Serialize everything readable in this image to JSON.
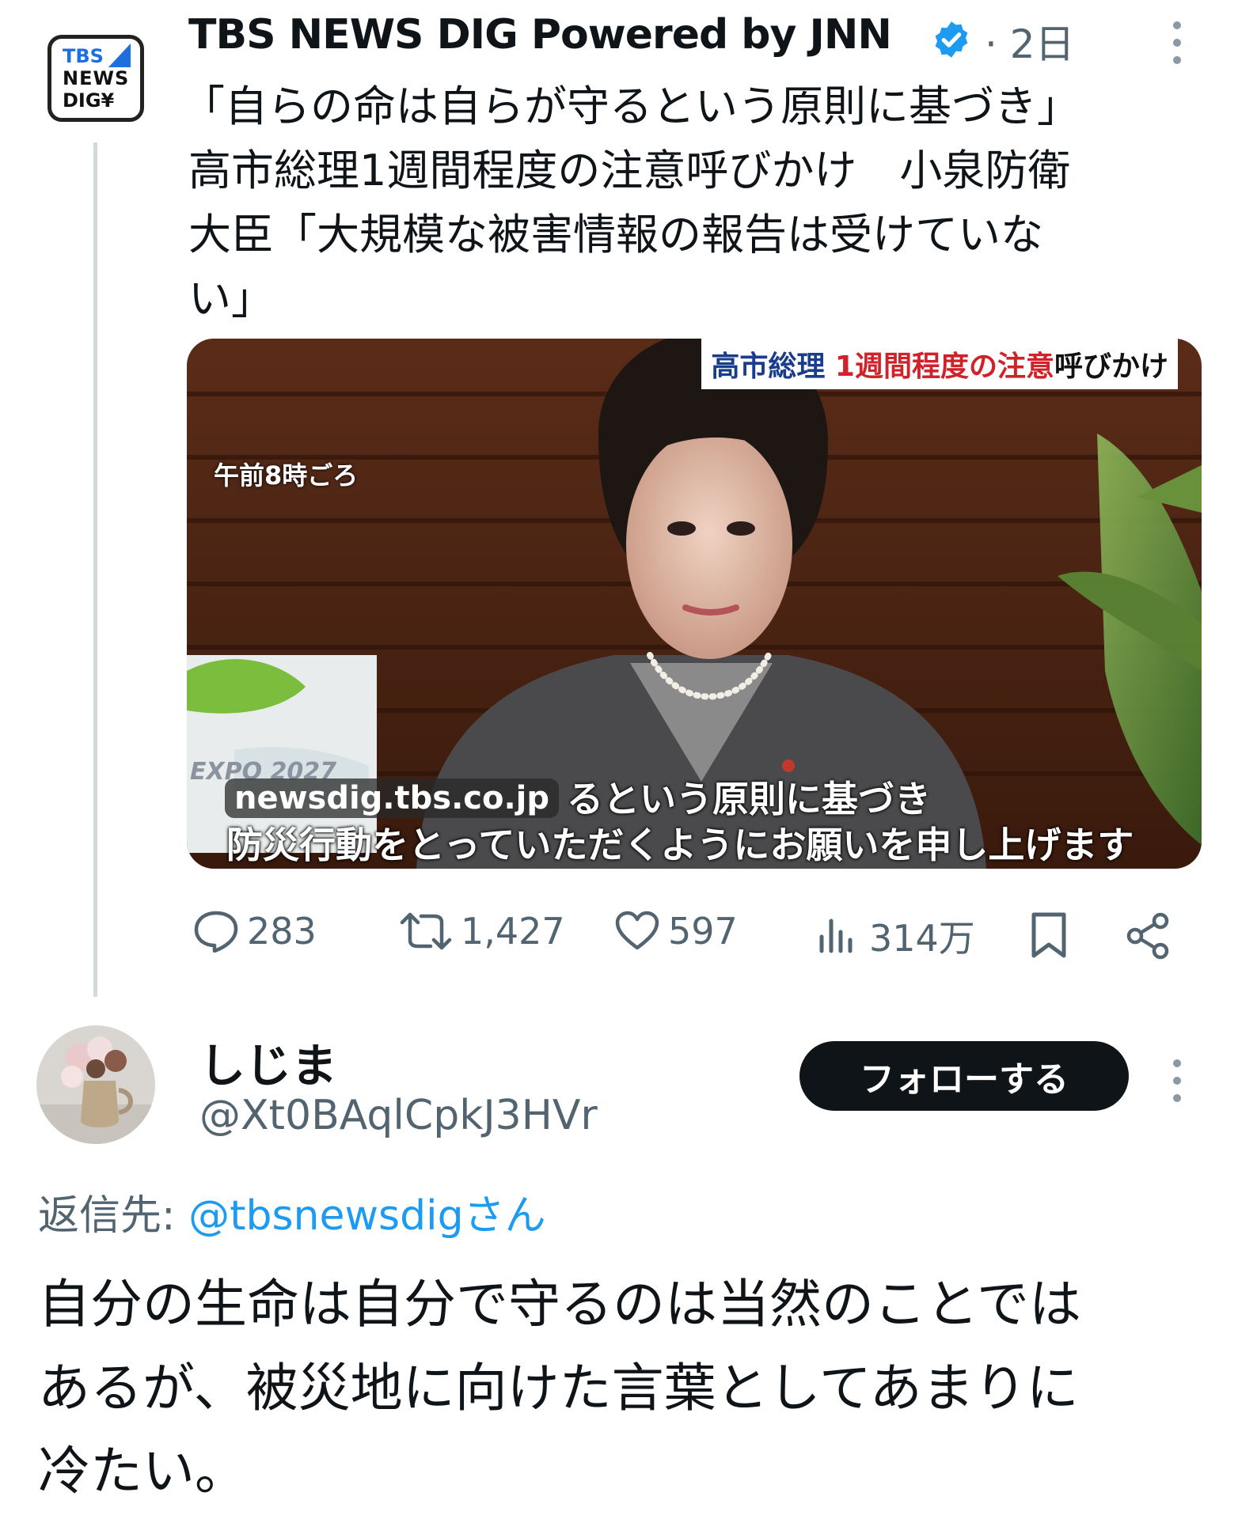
{
  "post": {
    "avatar": {
      "line1": "TBS",
      "line2": "NEWS",
      "line3": "DIG¥"
    },
    "author": "TBS NEWS DIG Powered by JNN",
    "verified_icon": "verified-badge-icon",
    "date": "· 2日",
    "text_line1": "「自らの命は自らが守るという原則に基づき」",
    "text_line2": "高市総理1週間程度の注意呼びかけ　小泉防衛",
    "text_line3": "大臣「大規模な被害情報の報告は受けていな",
    "text_line4": "い」",
    "media": {
      "tag_blue": "高市総理 ",
      "tag_red": "1週間程度の注意",
      "tag_black": "呼びかけ",
      "time_caption": "午前8時ごろ",
      "domain": "newsdig.tbs.co.jp",
      "subtitle_1": "るという原則に基づき",
      "subtitle_2": "防災行動をとっていただくようにお願いを申し上げます",
      "expo_label": "EXPO 2027"
    },
    "actions": {
      "replies": "283",
      "reposts": "1,427",
      "likes": "597",
      "views": "314万"
    }
  },
  "reply": {
    "name": "しじま",
    "handle": "@Xt0BAqlCpkJ3HVr",
    "follow_label": "フォローする",
    "reply_to_prefix": "返信先: ",
    "reply_to_mention": "@tbsnewsdigさん",
    "text_line1": "自分の生命は自分で守るのは当然のことでは",
    "text_line2": "あるが、被災地に向けた言葉としてあまりに",
    "text_line3": "冷たい。"
  },
  "colors": {
    "accent": "#1d9bf0",
    "secondary_text": "#536471",
    "primary_text": "#0f1419"
  }
}
